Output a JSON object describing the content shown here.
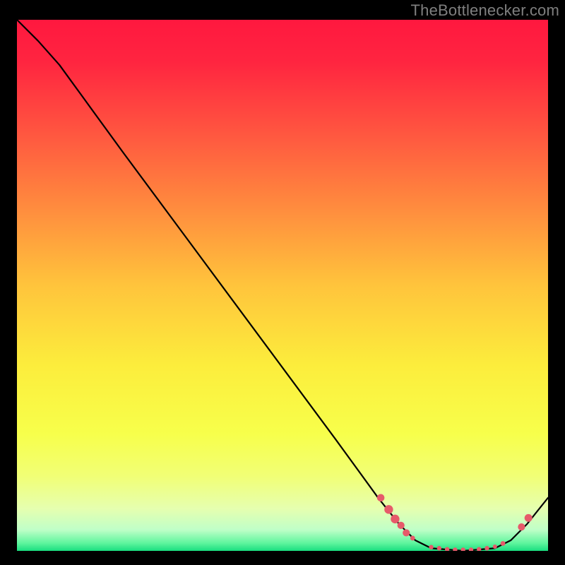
{
  "attribution": "TheBottlenecker.com",
  "chart_data": {
    "type": "line",
    "title": "",
    "xlabel": "",
    "ylabel": "",
    "xlim": [
      0,
      100
    ],
    "ylim": [
      0,
      100
    ],
    "background_gradient_stops": [
      {
        "pos": 0.0,
        "color": "#ff183f"
      },
      {
        "pos": 0.08,
        "color": "#ff2540"
      },
      {
        "pos": 0.2,
        "color": "#ff5140"
      },
      {
        "pos": 0.35,
        "color": "#ff8a3e"
      },
      {
        "pos": 0.5,
        "color": "#ffc43c"
      },
      {
        "pos": 0.65,
        "color": "#fced3c"
      },
      {
        "pos": 0.78,
        "color": "#f7ff4b"
      },
      {
        "pos": 0.86,
        "color": "#f1ff76"
      },
      {
        "pos": 0.92,
        "color": "#e6ffaf"
      },
      {
        "pos": 0.96,
        "color": "#c0ffc8"
      },
      {
        "pos": 0.985,
        "color": "#60f59e"
      },
      {
        "pos": 1.0,
        "color": "#19de7f"
      }
    ],
    "curve": [
      {
        "x": 0.0,
        "y": 100.0
      },
      {
        "x": 4.0,
        "y": 96.0
      },
      {
        "x": 8.0,
        "y": 91.5
      },
      {
        "x": 12.0,
        "y": 86.0
      },
      {
        "x": 20.0,
        "y": 75.0
      },
      {
        "x": 30.0,
        "y": 61.5
      },
      {
        "x": 40.0,
        "y": 48.0
      },
      {
        "x": 50.0,
        "y": 34.5
      },
      {
        "x": 60.0,
        "y": 21.0
      },
      {
        "x": 68.0,
        "y": 10.0
      },
      {
        "x": 72.0,
        "y": 5.0
      },
      {
        "x": 75.0,
        "y": 2.0
      },
      {
        "x": 78.0,
        "y": 0.5
      },
      {
        "x": 84.0,
        "y": 0.0
      },
      {
        "x": 90.0,
        "y": 0.5
      },
      {
        "x": 93.0,
        "y": 2.0
      },
      {
        "x": 96.0,
        "y": 5.0
      },
      {
        "x": 100.0,
        "y": 10.0
      }
    ],
    "marker_clusters": [
      {
        "label": "left-cluster",
        "color": "#e65a6a",
        "points": [
          {
            "x": 68.5,
            "y": 10.0,
            "r": 5.3
          },
          {
            "x": 70.0,
            "y": 7.8,
            "r": 6.2
          },
          {
            "x": 71.2,
            "y": 6.0,
            "r": 6.2
          },
          {
            "x": 72.3,
            "y": 4.8,
            "r": 5.1
          },
          {
            "x": 73.3,
            "y": 3.4,
            "r": 5.1
          },
          {
            "x": 74.5,
            "y": 2.4,
            "r": 3.4
          }
        ]
      },
      {
        "label": "bottom-dash",
        "color": "#e65a6a",
        "points": [
          {
            "x": 78.0,
            "y": 0.7,
            "r": 3.2
          },
          {
            "x": 79.5,
            "y": 0.5,
            "r": 3.2
          },
          {
            "x": 81.0,
            "y": 0.3,
            "r": 3.2
          },
          {
            "x": 82.5,
            "y": 0.2,
            "r": 3.2
          },
          {
            "x": 84.0,
            "y": 0.2,
            "r": 3.2
          },
          {
            "x": 85.5,
            "y": 0.2,
            "r": 3.2
          },
          {
            "x": 87.0,
            "y": 0.3,
            "r": 3.2
          },
          {
            "x": 88.5,
            "y": 0.5,
            "r": 3.2
          },
          {
            "x": 90.0,
            "y": 0.8,
            "r": 3.0
          }
        ]
      },
      {
        "label": "right-cluster",
        "color": "#e65a6a",
        "points": [
          {
            "x": 91.5,
            "y": 1.4,
            "r": 3.4
          },
          {
            "x": 95.0,
            "y": 4.5,
            "r": 5.1
          },
          {
            "x": 96.3,
            "y": 6.2,
            "r": 5.5
          }
        ]
      }
    ]
  }
}
